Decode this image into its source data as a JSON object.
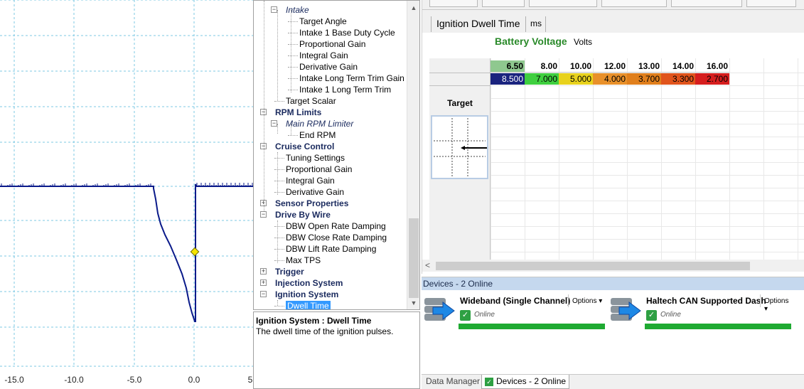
{
  "scope": {
    "x_ticks": [
      "-15.0",
      "-10.0",
      "-5.0",
      "0.0",
      "5"
    ]
  },
  "tree": {
    "items": [
      {
        "label": "Intake",
        "style": "italic",
        "level": 1,
        "expander": "minus"
      },
      {
        "label": "Target Angle",
        "style": "normal",
        "level": 2
      },
      {
        "label": "Intake 1 Base Duty Cycle",
        "style": "normal",
        "level": 2
      },
      {
        "label": "Proportional Gain",
        "style": "normal",
        "level": 2
      },
      {
        "label": "Integral Gain",
        "style": "normal",
        "level": 2
      },
      {
        "label": "Derivative Gain",
        "style": "normal",
        "level": 2
      },
      {
        "label": "Intake Long Term Trim Gain",
        "style": "normal",
        "level": 2
      },
      {
        "label": "Intake 1 Long Term Trim",
        "style": "normal",
        "level": 2
      },
      {
        "label": "Target Scalar",
        "style": "normal",
        "level": 1
      },
      {
        "label": "RPM Limits",
        "style": "bold",
        "level": 0,
        "expander": "minus"
      },
      {
        "label": "Main RPM Limiter",
        "style": "italic",
        "level": 1,
        "expander": "minus"
      },
      {
        "label": "End RPM",
        "style": "normal",
        "level": 2
      },
      {
        "label": "Cruise Control",
        "style": "bold",
        "level": 0,
        "expander": "minus"
      },
      {
        "label": "Tuning Settings",
        "style": "normal",
        "level": 1
      },
      {
        "label": "Proportional Gain",
        "style": "normal",
        "level": 1
      },
      {
        "label": "Integral Gain",
        "style": "normal",
        "level": 1
      },
      {
        "label": "Derivative Gain",
        "style": "normal",
        "level": 1
      },
      {
        "label": "Sensor Properties",
        "style": "bold",
        "level": 0,
        "expander": "plus"
      },
      {
        "label": "Drive By Wire",
        "style": "bold",
        "level": 0,
        "expander": "minus"
      },
      {
        "label": "DBW Open Rate Damping",
        "style": "normal",
        "level": 1
      },
      {
        "label": "DBW Close Rate Damping",
        "style": "normal",
        "level": 1
      },
      {
        "label": "DBW Lift Rate Damping",
        "style": "normal",
        "level": 1
      },
      {
        "label": "Max TPS",
        "style": "normal",
        "level": 1
      },
      {
        "label": "Trigger",
        "style": "bold",
        "level": 0,
        "expander": "plus"
      },
      {
        "label": "Injection System",
        "style": "bold",
        "level": 0,
        "expander": "plus"
      },
      {
        "label": "Ignition System",
        "style": "bold",
        "level": 0,
        "expander": "minus"
      },
      {
        "label": "Dwell Time",
        "style": "selected",
        "level": 1
      }
    ]
  },
  "description": {
    "title": "Ignition System : Dwell Time",
    "text": "The dwell time of the ignition pulses."
  },
  "table": {
    "title": "Ignition Dwell Time",
    "unit": "ms",
    "axis_name": "Battery Voltage",
    "axis_unit": "Volts",
    "row_label": "Target",
    "columns": [
      "6.50",
      "8.00",
      "10.00",
      "12.00",
      "13.00",
      "14.00",
      "16.00"
    ],
    "values": [
      "8.500",
      "7.000",
      "5.000",
      "4.000",
      "3.700",
      "3.300",
      "2.700"
    ],
    "cell_colors": [
      "#1a237e",
      "#3fcf3f",
      "#e8d21d",
      "#e8902a",
      "#e07f1c",
      "#e0541c",
      "#d61e1e"
    ],
    "text_colors": [
      "#ffffff",
      "#000000",
      "#000000",
      "#000000",
      "#000000",
      "#000000",
      "#000000"
    ],
    "active_column": "6.50"
  },
  "devices": {
    "header": "Devices - 2 Online",
    "list": [
      {
        "name": "Wideband (Single Channel)",
        "options": "Options",
        "status": "Online"
      },
      {
        "name": "Haltech CAN Supported Dash",
        "options": "Options",
        "status": "Online"
      }
    ]
  },
  "bottom_tabs": {
    "data_manager": "Data Manager",
    "devices": "Devices - 2 Online"
  },
  "colors": {
    "trace": "#0a1a8a",
    "marker": "#f5e400",
    "online_bar": "#1faa32",
    "devices_header": "#c5d8ee"
  }
}
